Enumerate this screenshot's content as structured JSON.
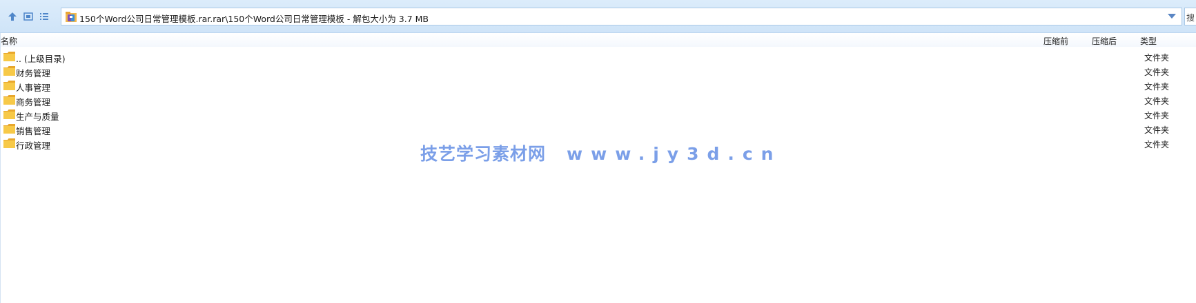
{
  "toolbar": {
    "up_icon": "arrow-up-icon",
    "view_icon": "thumbnail-view-icon",
    "list_icon": "list-view-icon"
  },
  "address": {
    "icon": "archive-icon",
    "path": "150个Word公司日常管理模板.rar.rar\\150个Word公司日常管理模板 - 解包大小为 3.7 MB"
  },
  "search": {
    "label": "搜"
  },
  "columns": {
    "name": "名称",
    "compressed": "压缩前",
    "uncompressed": "压缩后",
    "type": "类型"
  },
  "rows": [
    {
      "name": ".. (上级目录)",
      "type": "文件夹"
    },
    {
      "name": "财务管理",
      "type": "文件夹"
    },
    {
      "name": "人事管理",
      "type": "文件夹"
    },
    {
      "name": "商务管理",
      "type": "文件夹"
    },
    {
      "name": "生产与质量",
      "type": "文件夹"
    },
    {
      "name": "销售管理",
      "type": "文件夹"
    },
    {
      "name": "行政管理",
      "type": "文件夹"
    }
  ],
  "watermark": {
    "site_name": "技艺学习素材网",
    "url": "www.jy3d.cn"
  },
  "colors": {
    "accent": "#5a86c4",
    "folder": "#f5c542",
    "watermark": "#6d95e6"
  }
}
